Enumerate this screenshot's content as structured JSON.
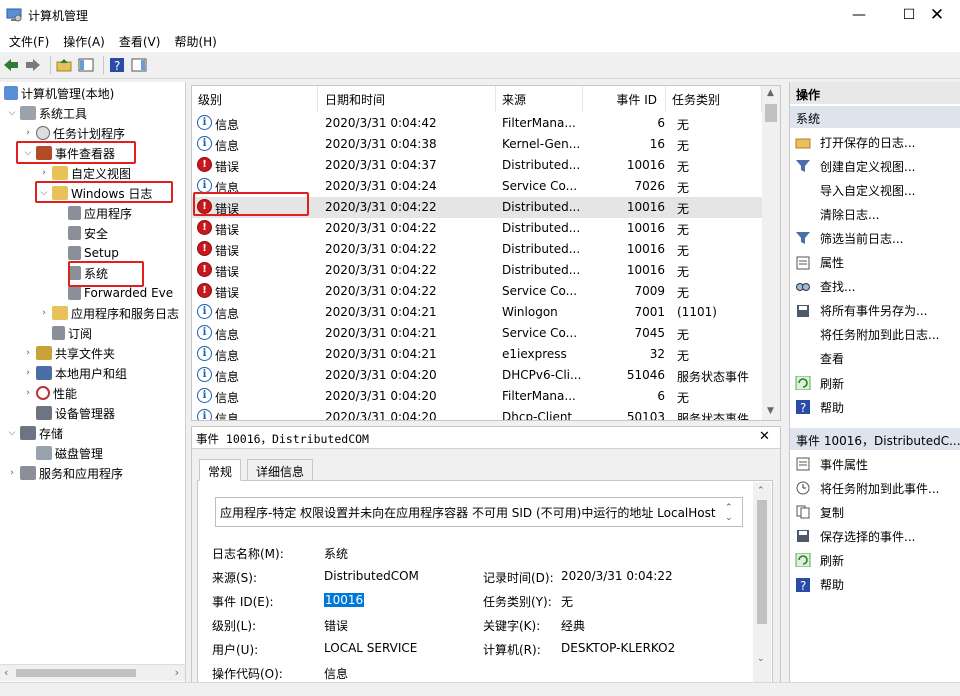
{
  "window": {
    "title": "计算机管理"
  },
  "menu": [
    "文件(F)",
    "操作(A)",
    "查看(V)",
    "帮助(H)"
  ],
  "tree": {
    "root": "计算机管理(本地)",
    "system_tools": "系统工具",
    "task_scheduler": "任务计划程序",
    "event_viewer": "事件查看器",
    "custom_views": "自定义视图",
    "windows_logs": "Windows 日志",
    "application": "应用程序",
    "security": "安全",
    "setup": "Setup",
    "system": "系统",
    "forwarded": "Forwarded Eve",
    "apps_services": "应用程序和服务日志",
    "subscriptions": "订阅",
    "shared_folders": "共享文件夹",
    "local_users": "本地用户和组",
    "performance": "性能",
    "device_manager": "设备管理器",
    "storage": "存储",
    "disk_management": "磁盘管理",
    "services_apps": "服务和应用程序"
  },
  "list": {
    "columns": [
      "级别",
      "日期和时间",
      "来源",
      "事件 ID",
      "任务类别"
    ],
    "rows": [
      {
        "level": "信息",
        "type": "info",
        "time": "2020/3/31 0:04:42",
        "source": "FilterMana...",
        "id": "6",
        "cat": "无"
      },
      {
        "level": "信息",
        "type": "info",
        "time": "2020/3/31 0:04:38",
        "source": "Kernel-Gen...",
        "id": "16",
        "cat": "无"
      },
      {
        "level": "错误",
        "type": "error",
        "time": "2020/3/31 0:04:37",
        "source": "Distributed...",
        "id": "10016",
        "cat": "无"
      },
      {
        "level": "信息",
        "type": "info",
        "time": "2020/3/31 0:04:24",
        "source": "Service Co...",
        "id": "7026",
        "cat": "无"
      },
      {
        "level": "错误",
        "type": "error",
        "time": "2020/3/31 0:04:22",
        "source": "Distributed...",
        "id": "10016",
        "cat": "无"
      },
      {
        "level": "错误",
        "type": "error",
        "time": "2020/3/31 0:04:22",
        "source": "Distributed...",
        "id": "10016",
        "cat": "无"
      },
      {
        "level": "错误",
        "type": "error",
        "time": "2020/3/31 0:04:22",
        "source": "Distributed...",
        "id": "10016",
        "cat": "无"
      },
      {
        "level": "错误",
        "type": "error",
        "time": "2020/3/31 0:04:22",
        "source": "Distributed...",
        "id": "10016",
        "cat": "无"
      },
      {
        "level": "错误",
        "type": "error",
        "time": "2020/3/31 0:04:22",
        "source": "Service Co...",
        "id": "7009",
        "cat": "无"
      },
      {
        "level": "信息",
        "type": "info",
        "time": "2020/3/31 0:04:21",
        "source": "Winlogon",
        "id": "7001",
        "cat": "(1101)"
      },
      {
        "level": "信息",
        "type": "info",
        "time": "2020/3/31 0:04:21",
        "source": "Service Co...",
        "id": "7045",
        "cat": "无"
      },
      {
        "level": "信息",
        "type": "info",
        "time": "2020/3/31 0:04:21",
        "source": "e1iexpress",
        "id": "32",
        "cat": "无"
      },
      {
        "level": "信息",
        "type": "info",
        "time": "2020/3/31 0:04:20",
        "source": "DHCPv6-Cli...",
        "id": "51046",
        "cat": "服务状态事件"
      },
      {
        "level": "信息",
        "type": "info",
        "time": "2020/3/31 0:04:20",
        "source": "FilterMana...",
        "id": "6",
        "cat": "无"
      },
      {
        "level": "信息",
        "type": "info",
        "time": "2020/3/31 0:04:20",
        "source": "Dhcp-Client",
        "id": "50103",
        "cat": "服务状态事件"
      }
    ],
    "selected_index": 4
  },
  "detail": {
    "header": "事件 10016，DistributedCOM",
    "tabs": [
      "常规",
      "详细信息"
    ],
    "description": "应用程序-特定 权限设置并未向在应用程序容器 不可用 SID (不可用)中运行的地址 LocalHost",
    "fields": {
      "log_name_label": "日志名称(M):",
      "log_name": "系统",
      "source_label": "来源(S):",
      "source": "DistributedCOM",
      "logged_label": "记录时间(D):",
      "logged": "2020/3/31 0:04:22",
      "event_id_label": "事件 ID(E):",
      "event_id": "10016",
      "task_label": "任务类别(Y):",
      "task": "无",
      "level_label": "级别(L):",
      "level": "错误",
      "keywords_label": "关键字(K):",
      "keywords": "经典",
      "user_label": "用户(U):",
      "user": "LOCAL SERVICE",
      "computer_label": "计算机(R):",
      "computer": "DESKTOP-KLERKO2",
      "opcode_label": "操作代码(O):",
      "opcode": "信息"
    }
  },
  "actions": {
    "title": "操作",
    "section1": "系统",
    "items1": [
      {
        "label": "打开保存的日志...",
        "icon": "folder-open-icon"
      },
      {
        "label": "创建自定义视图...",
        "icon": "filter-icon"
      },
      {
        "label": "导入自定义视图...",
        "icon": "blank"
      },
      {
        "label": "清除日志...",
        "icon": "blank"
      },
      {
        "label": "筛选当前日志...",
        "icon": "filter-icon"
      },
      {
        "label": "属性",
        "icon": "properties-icon"
      },
      {
        "label": "查找...",
        "icon": "find-icon"
      },
      {
        "label": "将所有事件另存为...",
        "icon": "save-icon"
      },
      {
        "label": "将任务附加到此日志...",
        "icon": "blank"
      },
      {
        "label": "查看",
        "icon": "blank"
      },
      {
        "label": "刷新",
        "icon": "refresh-icon"
      },
      {
        "label": "帮助",
        "icon": "help-icon"
      }
    ],
    "section2": "事件 10016，DistributedC...",
    "items2": [
      {
        "label": "事件属性",
        "icon": "properties-icon"
      },
      {
        "label": "将任务附加到此事件...",
        "icon": "task-icon"
      },
      {
        "label": "复制",
        "icon": "copy-icon"
      },
      {
        "label": "保存选择的事件...",
        "icon": "save-icon"
      },
      {
        "label": "刷新",
        "icon": "refresh-icon"
      },
      {
        "label": "帮助",
        "icon": "help-icon"
      }
    ]
  },
  "colors": {
    "highlight_box": "#e0201c",
    "selection": "#0078d7",
    "error": "#c8181d",
    "info": "#1c5fb0"
  }
}
